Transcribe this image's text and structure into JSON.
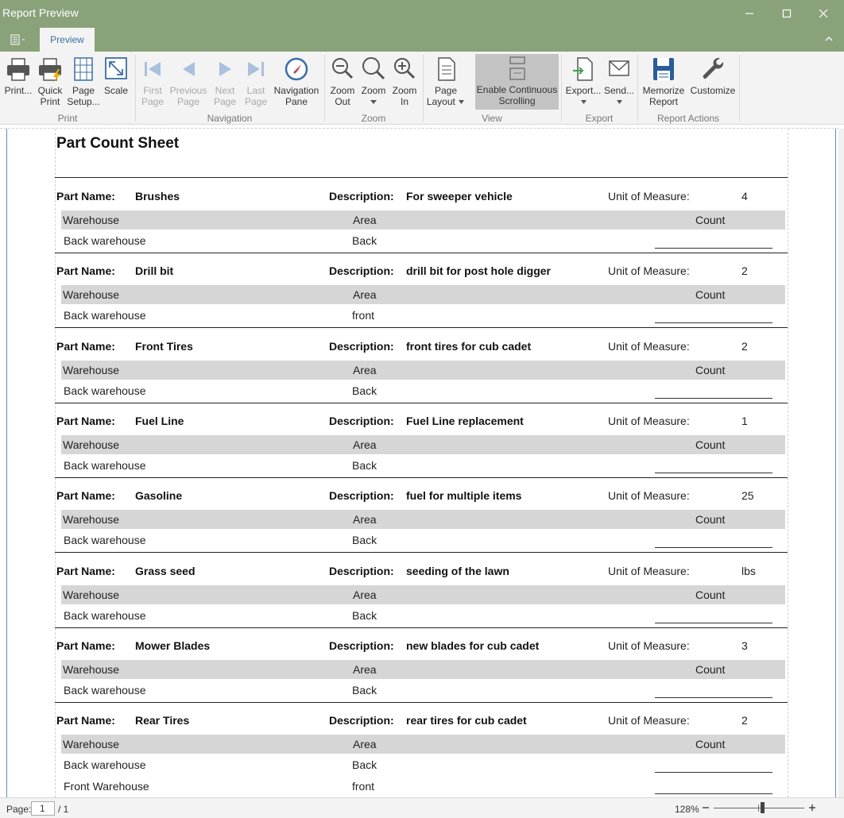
{
  "window": {
    "title": "Report Preview"
  },
  "tabs": {
    "preview": "Preview"
  },
  "ribbon": {
    "print": "Print...",
    "quick_print_1": "Quick",
    "quick_print_2": "Print",
    "page_setup_1": "Page",
    "page_setup_2": "Setup...",
    "scale": "Scale",
    "first_page_1": "First",
    "first_page_2": "Page",
    "previous_page_1": "Previous",
    "previous_page_2": "Page",
    "next_page_1": "Next",
    "next_page_2": "Page",
    "last_page_1": "Last",
    "last_page_2": "Page",
    "navigation_pane_1": "Navigation",
    "navigation_pane_2": "Pane",
    "zoom_out_1": "Zoom",
    "zoom_out_2": "Out",
    "zoom_1": "Zoom",
    "zoom_in_1": "Zoom",
    "zoom_in_2": "In",
    "page_layout_1": "Page",
    "page_layout_2": "Layout",
    "continuous_1": "Enable Continuous",
    "continuous_2": "Scrolling",
    "export": "Export...",
    "send": "Send...",
    "memorize_1": "Memorize",
    "memorize_2": "Report",
    "customize": "Customize",
    "groups": {
      "print": "Print",
      "navigation": "Navigation",
      "zoom": "Zoom",
      "view": "View",
      "export": "Export",
      "report_actions": "Report Actions"
    }
  },
  "report": {
    "title": "Part Count Sheet",
    "labels": {
      "part_name": "Part Name:",
      "description": "Description:",
      "unit_of_measure": "Unit of Measure:",
      "warehouse": "Warehouse",
      "area": "Area",
      "count": "Count"
    },
    "parts": [
      {
        "name": "Brushes",
        "description": "For sweeper vehicle",
        "uom": "4",
        "rows": [
          {
            "warehouse": "Back warehouse",
            "area": "Back"
          }
        ]
      },
      {
        "name": "Drill bit",
        "description": "drill bit for post hole digger",
        "uom": "2",
        "rows": [
          {
            "warehouse": "Back warehouse",
            "area": "front"
          }
        ]
      },
      {
        "name": "Front Tires",
        "description": "front tires for cub cadet",
        "uom": "2",
        "rows": [
          {
            "warehouse": "Back warehouse",
            "area": "Back"
          }
        ]
      },
      {
        "name": "Fuel Line",
        "description": "Fuel Line replacement",
        "uom": "1",
        "rows": [
          {
            "warehouse": "Back warehouse",
            "area": "Back"
          }
        ]
      },
      {
        "name": "Gasoline",
        "description": "fuel for multiple items",
        "uom": "25",
        "rows": [
          {
            "warehouse": "Back warehouse",
            "area": "Back"
          }
        ]
      },
      {
        "name": "Grass seed",
        "description": "seeding of the lawn",
        "uom": "lbs",
        "rows": [
          {
            "warehouse": "Back warehouse",
            "area": "Back"
          }
        ]
      },
      {
        "name": "Mower Blades",
        "description": "new blades for cub cadet",
        "uom": "3",
        "rows": [
          {
            "warehouse": "Back warehouse",
            "area": "Back"
          }
        ]
      },
      {
        "name": "Rear Tires",
        "description": "rear tires for cub cadet",
        "uom": "2",
        "rows": [
          {
            "warehouse": "Back warehouse",
            "area": "Back"
          },
          {
            "warehouse": "Front Warehouse",
            "area": "front"
          }
        ]
      }
    ]
  },
  "status": {
    "page_label": "Page:",
    "page_value": "1",
    "page_of": "/ 1",
    "zoom": "128%"
  }
}
